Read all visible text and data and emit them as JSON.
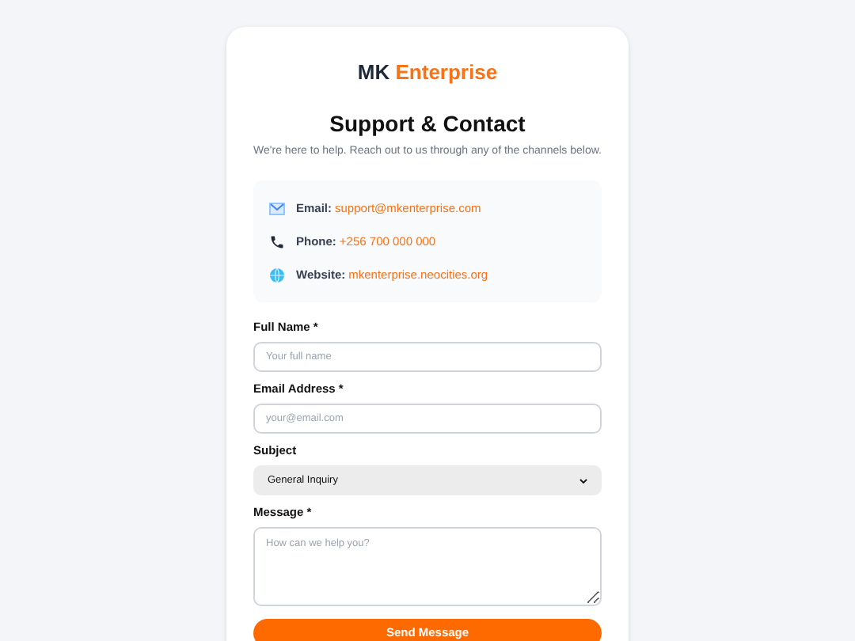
{
  "brand": {
    "first": "MK",
    "second": "Enterprise"
  },
  "title": "Support & Contact",
  "subtitle": "We're here to help. Reach out to us through any of the channels below.",
  "contacts": [
    {
      "kind": "email",
      "label": "Email:",
      "value": "support@mkenterprise.com"
    },
    {
      "kind": "phone",
      "label": "Phone:",
      "value": "+256 700 000 000"
    },
    {
      "kind": "web",
      "label": "Website:",
      "value": "mkenterprise.neocities.org"
    }
  ],
  "form": [
    {
      "kind": "input",
      "label": "Full Name *",
      "placeholder": "Your full name"
    },
    {
      "kind": "input",
      "label": "Email Address *",
      "placeholder": "your@email.com"
    },
    {
      "kind": "select",
      "label": "Subject",
      "value": "General Inquiry"
    },
    {
      "kind": "textarea",
      "label": "Message *",
      "placeholder": "How can we help you?"
    }
  ],
  "submit": "Send Message"
}
